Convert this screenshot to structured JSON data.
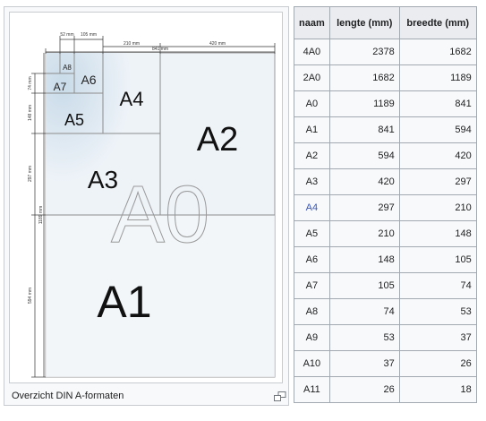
{
  "figure": {
    "caption": "Overzicht DIN A-formaten",
    "labels": {
      "a0": "A0",
      "a1": "A1",
      "a2": "A2",
      "a3": "A3",
      "a4": "A4",
      "a5": "A5",
      "a6": "A6",
      "a7": "A7",
      "a8": "A8"
    },
    "dimensions": {
      "top_a8": "52 mm",
      "top_a6": "105 mm",
      "top_a4": "210 mm",
      "top_a2": "420 mm",
      "top_a0": "841 mm",
      "left_a7": "74 mm",
      "left_a5": "148 mm",
      "left_a3": "297 mm",
      "left_a1": "594 mm",
      "left_a0": "1189 mm"
    },
    "magnify_icon": "magnify-icon"
  },
  "table": {
    "headers": {
      "name": "naam",
      "length": "lengte (mm)",
      "width": "breedte (mm)"
    },
    "link_color": "#3a56b5",
    "rows": [
      {
        "name": "4A0",
        "length": "2378",
        "width": "1682",
        "linked": false
      },
      {
        "name": "2A0",
        "length": "1682",
        "width": "1189",
        "linked": false
      },
      {
        "name": "A0",
        "length": "1189",
        "width": "841",
        "linked": false
      },
      {
        "name": "A1",
        "length": "841",
        "width": "594",
        "linked": false
      },
      {
        "name": "A2",
        "length": "594",
        "width": "420",
        "linked": false
      },
      {
        "name": "A3",
        "length": "420",
        "width": "297",
        "linked": false
      },
      {
        "name": "A4",
        "length": "297",
        "width": "210",
        "linked": true
      },
      {
        "name": "A5",
        "length": "210",
        "width": "148",
        "linked": false
      },
      {
        "name": "A6",
        "length": "148",
        "width": "105",
        "linked": false
      },
      {
        "name": "A7",
        "length": "105",
        "width": "74",
        "linked": false
      },
      {
        "name": "A8",
        "length": "74",
        "width": "53",
        "linked": false
      },
      {
        "name": "A9",
        "length": "53",
        "width": "37",
        "linked": false
      },
      {
        "name": "A10",
        "length": "37",
        "width": "26",
        "linked": false
      },
      {
        "name": "A11",
        "length": "26",
        "width": "18",
        "linked": false
      }
    ]
  }
}
